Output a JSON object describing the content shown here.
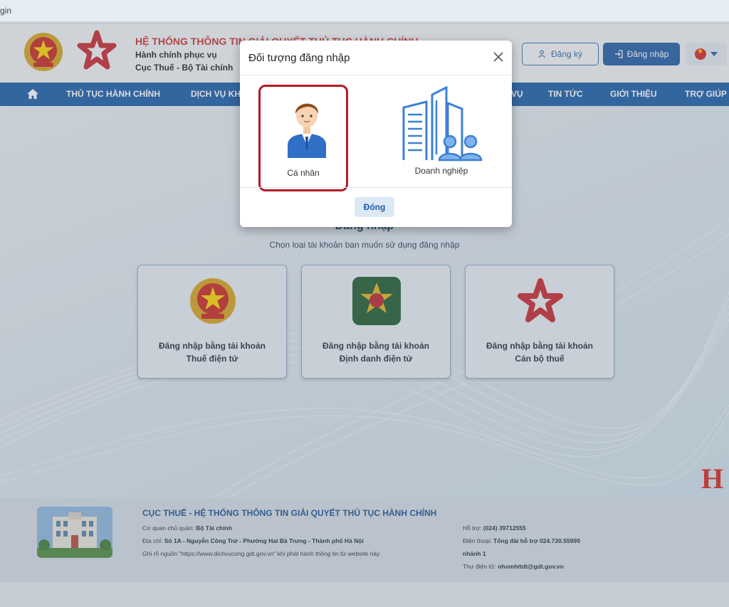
{
  "browser": {
    "address_fragment": "gin"
  },
  "header": {
    "title": "HỆ THỐNG THÔNG TIN GIẢI QUYẾT THỦ TỤC HÀNH CHÍNH",
    "subtitle1": "Hành chính phục vụ",
    "subtitle2": "Cục Thuế - Bộ Tài chính",
    "register_label": "Đăng ký",
    "login_label": "Đăng nhập",
    "language_flag": "vietnam-flag-icon"
  },
  "nav": {
    "items": [
      {
        "label": "THỦ TỤC HÀNH CHÍNH"
      },
      {
        "label": "DỊCH VỤ KH"
      },
      {
        "label": "VỤ"
      },
      {
        "label": "TIN TỨC"
      },
      {
        "label": "GIỚI THIỆU"
      },
      {
        "label": "TRỢ GIÚP"
      }
    ]
  },
  "main": {
    "heading": "Đăng nhập",
    "subheading": "Chọn loại tài khoản bạn muốn sử dụng đăng nhập",
    "cards": [
      {
        "line1": "Đăng nhập bằng tài khoản",
        "line2": "Thuế điện tử",
        "icon": "national-emblem-icon"
      },
      {
        "line1": "Đăng nhập bằng tài khoản",
        "line2": "Định danh điện tử",
        "icon": "vneid-icon"
      },
      {
        "line1": "Đăng nhập bằng tài khoản",
        "line2": "Cán bộ thuế",
        "icon": "star-logo-icon"
      }
    ],
    "watermark_letter": "H"
  },
  "modal": {
    "title": "Đối tượng đăng nhập",
    "options": [
      {
        "label": "Cá nhân",
        "icon": "person-icon",
        "selected": true
      },
      {
        "label": "Doanh nghiệp",
        "icon": "building-icon",
        "selected": false
      }
    ],
    "close_button_label": "Đóng"
  },
  "footer": {
    "title": "CỤC THUẾ - HỆ THỐNG THÔNG TIN GIẢI QUYẾT THỦ TỤC HÀNH CHÍNH",
    "agency_label": "Cơ quan chủ quản:",
    "agency_value": "Bộ Tài chính",
    "address_label": "Địa chỉ:",
    "address_value": "Số 1A - Nguyễn Công Trứ - Phường Hai Bà Trưng - Thành phố Hà Nội",
    "source_note": "Ghi rõ nguồn \"https://www.dichvucong.gdt.gov.vn\" khi phát hành thông tin từ website này",
    "support_label": "Hỗ trợ:",
    "support_value": "(024) 39712555",
    "phone_label": "Điện thoại:",
    "phone_value": "Tổng đài hỗ trợ 024.730.55999",
    "phone_ext": "nhánh 1",
    "email_label": "Thư điện tử:",
    "email_value": "nhomhttdt@gdt.gov.vn"
  },
  "colors": {
    "brand_blue": "#1a5aa6",
    "brand_red": "#c8322d",
    "selection_border": "#b11c26"
  }
}
